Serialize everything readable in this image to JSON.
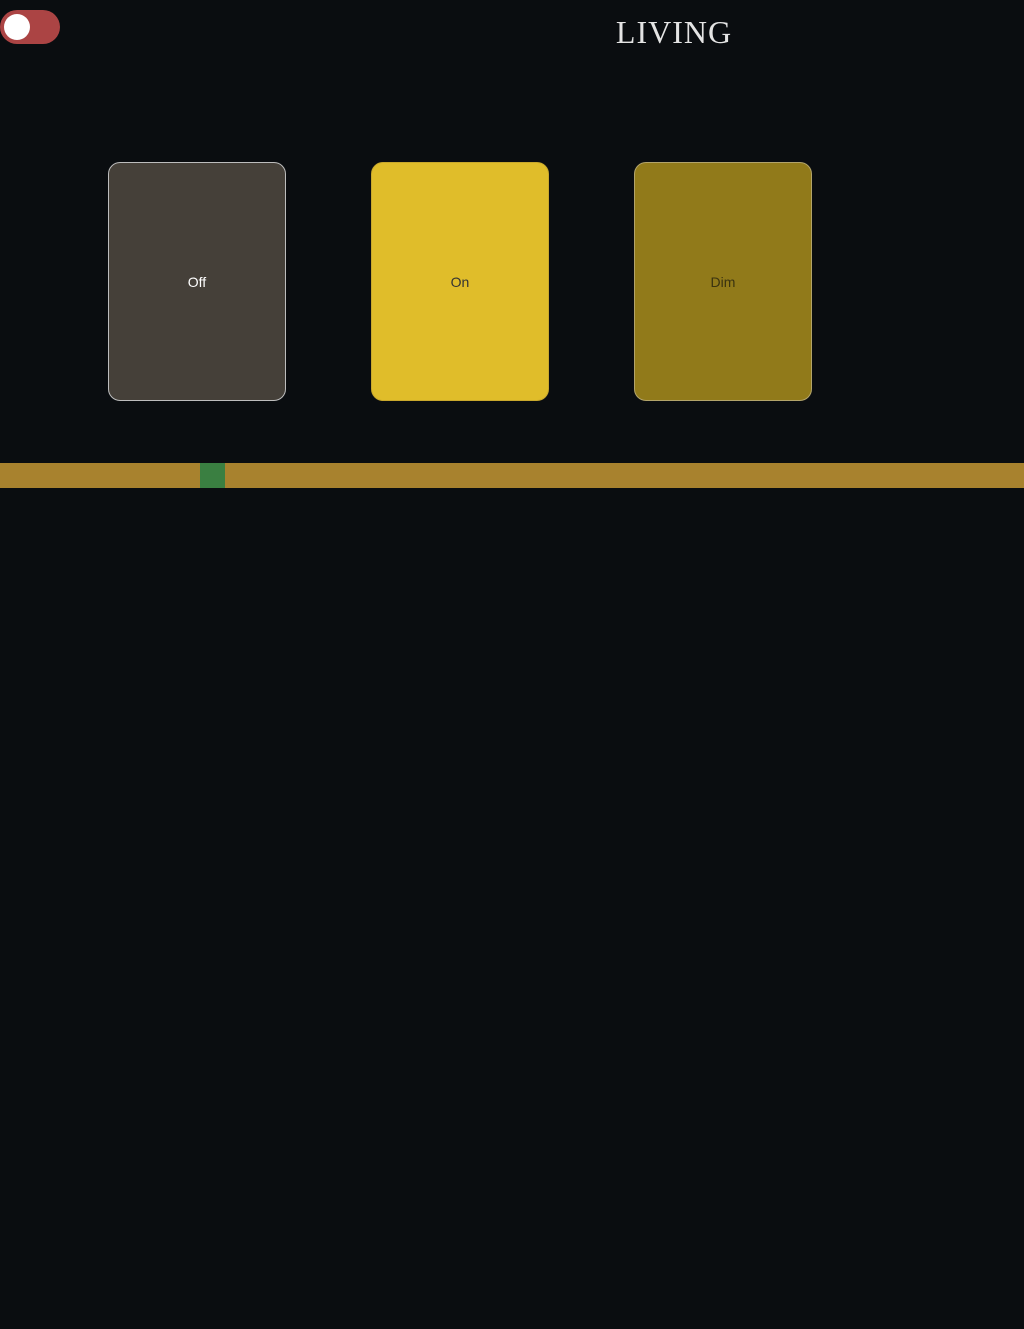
{
  "header": {
    "room_title": "LIVING",
    "power_toggle": {
      "on": false,
      "track_color": "#ab4444",
      "knob_color": "#ffffff"
    }
  },
  "scenes": [
    {
      "label": "Off",
      "color": "#454039"
    },
    {
      "label": "On",
      "color": "#e0bd2a"
    },
    {
      "label": "Dim",
      "color": "#917a1a"
    }
  ],
  "brightness_slider": {
    "value_fraction": 0.2,
    "track_color": "#a8822e",
    "thumb_color": "#3a7f41"
  }
}
